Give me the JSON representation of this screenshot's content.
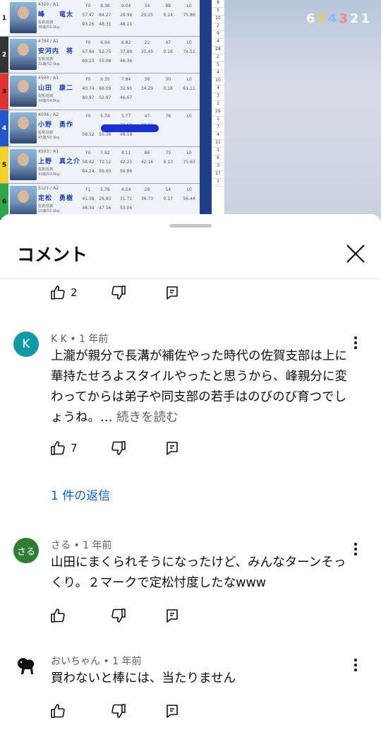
{
  "video": {
    "racers": [
      {
        "lane": "1",
        "reg": "4320 / A1",
        "name": "峰　　竜太",
        "sub1": "佐賀/佐賀",
        "sub2": "38歳/52.0kg",
        "r1": [
          "F0",
          "8.38",
          "9.04",
          "34",
          "88"
        ],
        "r2": [
          "L0",
          "57.47",
          "84.27",
          "29.96",
          "29.25"
        ],
        "r3": [
          "0.14",
          "75.86",
          "93.26",
          "48.31",
          "48.11"
        ]
      },
      {
        "lane": "2",
        "reg": "4794 / A1",
        "name": "安河内　将",
        "sub1": "佐賀/佐賀",
        "sub2": "31歳/52.0kg",
        "r1": [
          "F0",
          "6.94",
          "6.82",
          "22",
          "47"
        ],
        "r2": [
          "L0",
          "57.84",
          "52.75",
          "37.89",
          "35.45"
        ],
        "r3": [
          "0.16",
          "74.51",
          "69.23",
          "55.08",
          "46.36"
        ]
      },
      {
        "lane": "3",
        "reg": "4500 / A1",
        "name": "山田　康二",
        "sub1": "佐賀/佐賀",
        "sub2": "34歳/54.0kg",
        "r1": [
          "F0",
          "6.35",
          "7.84",
          "38",
          "30"
        ],
        "r2": [
          "L0",
          "40.74",
          "66.09",
          "32.95",
          "34.29"
        ],
        "r3": [
          "0.16",
          "61.11",
          "80.87",
          "52.87",
          "46.67"
        ]
      },
      {
        "lane": "4",
        "reg": "4006 / A2",
        "name": "小野　勇作",
        "sub1": "佐賀/佐賀",
        "sub2": "43歳/50.5kg",
        "r1": [
          "F0",
          "5.74",
          "5.77",
          "47",
          "76"
        ],
        "r2": [
          "L0",
          "",
          "",
          "33.08",
          "30.91"
        ],
        "r3": [
          "",
          "",
          "58.52",
          "50.38",
          "48.18"
        ]
      },
      {
        "lane": "5",
        "reg": "4503 / A1",
        "name": "上野　真之介",
        "sub1": "佐賀/佐賀",
        "sub2": "33歳/52.0kg",
        "r1": [
          "F0",
          "7.92",
          "8.11",
          "86",
          "75"
        ],
        "r2": [
          "L0",
          "58.62",
          "72.12",
          "42.25",
          "42.16"
        ],
        "r3": [
          "0.13",
          "75.63",
          "84.24",
          "56.60",
          "56.86"
        ]
      },
      {
        "lane": "6",
        "reg": "5121 / A2",
        "name": "定松　勇樹",
        "sub1": "佐賀/佐賀",
        "sub2": "20歳/52.0kg",
        "r1": [
          "F1",
          "5.78",
          "4.54",
          "29",
          "54"
        ],
        "r2": [
          "L0",
          "41.58",
          "26.83",
          "31.71",
          "36.73"
        ],
        "r3": [
          "0.17",
          "56.44",
          "46.34",
          "47.56",
          "53.06"
        ]
      }
    ],
    "lane_digits": [
      "6",
      "5",
      "4",
      "3",
      "2",
      "1"
    ]
  },
  "sheet": {
    "title": "コメント"
  },
  "colors": {
    "accent": "#065fd4",
    "avatar_kk": "#119aa6",
    "avatar_saru": "#2e7d32"
  },
  "comments": [
    {
      "likes": "2"
    },
    {
      "author": "K K",
      "time": "1 年前",
      "avatar_letter": "K",
      "text": "上瀧が親分で長溝が補佐やった時代の佐賀支部は上に華持たせろよスタイルやったと思うから、峰親分に変わってからは弟子や同支部の若手はのびのび育つでしょうね。…",
      "read_more": "続きを読む",
      "likes": "7",
      "replies": "1 件の返信"
    },
    {
      "author": "さる",
      "time": "1 年前",
      "avatar_letter": "さる",
      "text": "山田にまくられそうになったけど、みんなターンそっくり。２マークで定松忖度したなwww",
      "likes": ""
    },
    {
      "author": "おいちゃん",
      "time": "1 年前",
      "text": "買わないと棒には、当たりません",
      "likes": ""
    }
  ]
}
